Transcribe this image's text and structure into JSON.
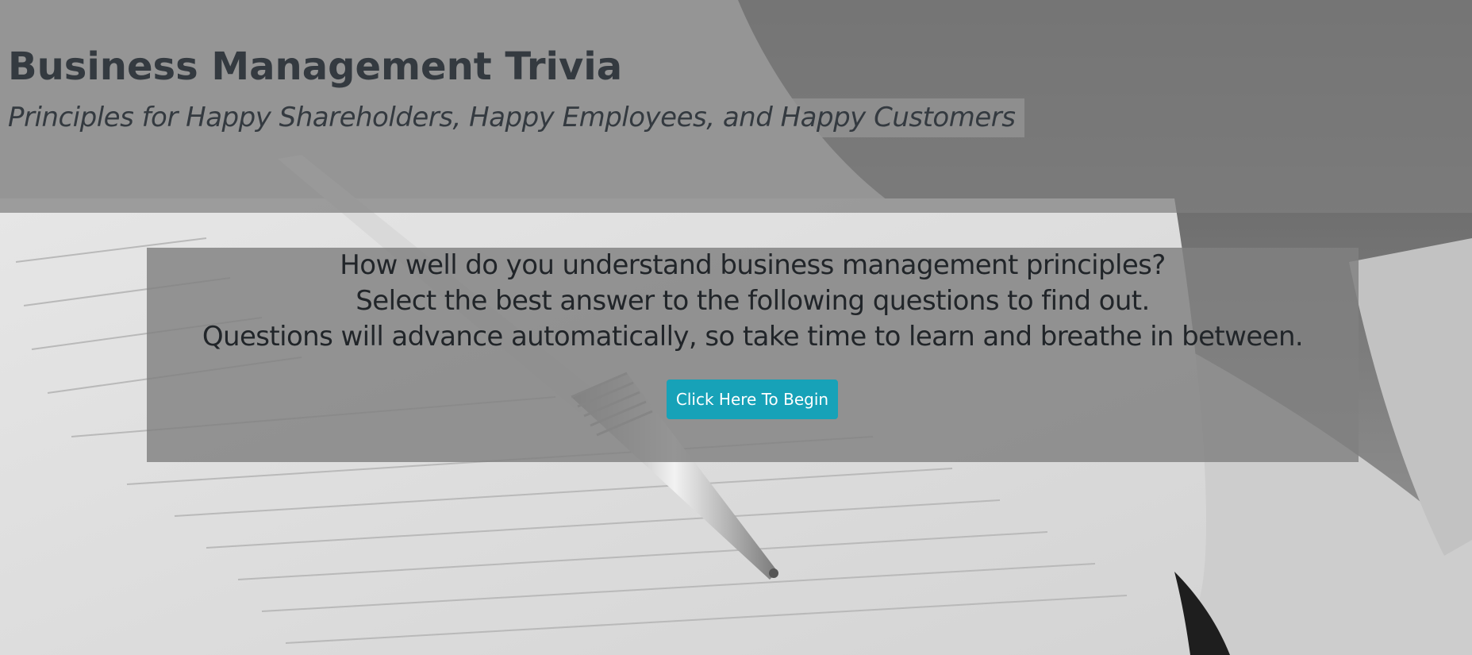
{
  "header": {
    "title": "Business Management Trivia",
    "subtitle": "Principles for Happy Shareholders, Happy Employees, and Happy Customers"
  },
  "intro": {
    "lines": [
      "How well do you understand business management principles?",
      "Select the best answer to the following questions to find out.",
      "Questions will advance automatically, so take time to learn and breathe in between."
    ]
  },
  "start_button": {
    "label": "Click Here To Begin",
    "color": "#17a2b8"
  },
  "background": {
    "description_icon": "notebook-pen-laptop-photo"
  }
}
